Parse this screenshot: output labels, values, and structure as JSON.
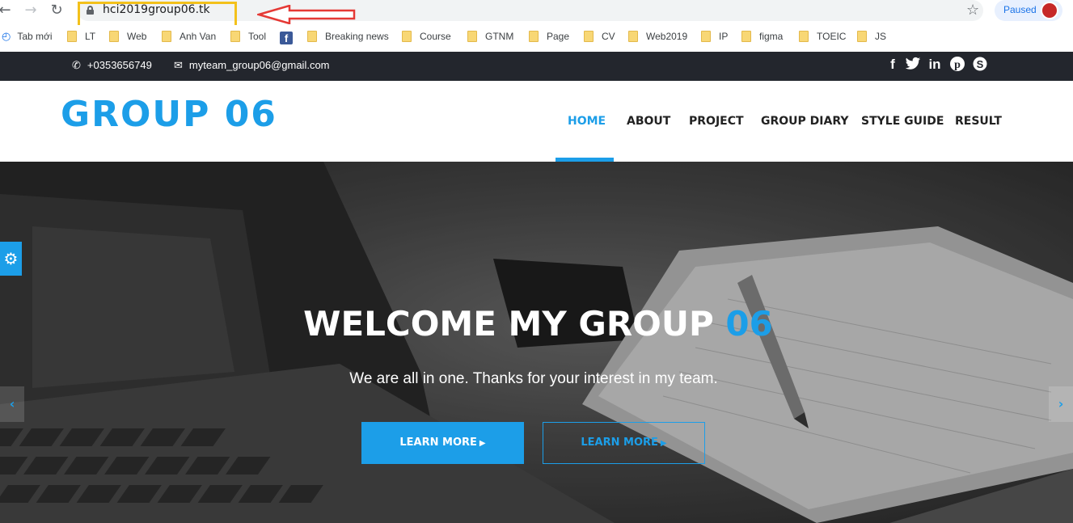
{
  "browser": {
    "url": "hci2019group06.tk",
    "profile_status": "Paused",
    "bookmarks": [
      {
        "label": "Tab mới",
        "kind": "history"
      },
      {
        "label": "LT",
        "kind": "folder"
      },
      {
        "label": "Web",
        "kind": "folder"
      },
      {
        "label": "Anh Van",
        "kind": "folder"
      },
      {
        "label": "Tool",
        "kind": "folder"
      },
      {
        "label": "",
        "kind": "facebook"
      },
      {
        "label": "Breaking news",
        "kind": "folder"
      },
      {
        "label": "Course",
        "kind": "folder"
      },
      {
        "label": "GTNM",
        "kind": "folder"
      },
      {
        "label": "Page",
        "kind": "folder"
      },
      {
        "label": "CV",
        "kind": "folder"
      },
      {
        "label": "Web2019",
        "kind": "folder"
      },
      {
        "label": "IP",
        "kind": "folder"
      },
      {
        "label": "figma",
        "kind": "folder"
      },
      {
        "label": "TOEIC",
        "kind": "folder"
      },
      {
        "label": "JS",
        "kind": "folder"
      }
    ],
    "annotation_color": "#f3c11b",
    "arrow_color": "#e53935"
  },
  "topbar": {
    "phone": "+0353656749",
    "email": "myteam_group06@gmail.com",
    "social_icons": [
      "facebook-icon",
      "twitter-icon",
      "linkedin-icon",
      "pinterest-icon",
      "skype-icon"
    ]
  },
  "header": {
    "logo": "GROUP 06",
    "menu": [
      "HOME",
      "ABOUT",
      "PROJECT",
      "GROUP DIARY",
      "STYLE GUIDE",
      "RESULT"
    ],
    "active_item": "HOME",
    "accent_color": "#1c9ee8"
  },
  "hero": {
    "title_main": "WELCOME MY GROUP ",
    "title_highlight": "06",
    "subtitle": "We are all in one. Thanks for your interest in my team.",
    "button_primary": "LEARN MORE",
    "button_secondary": "LEARN MORE"
  }
}
